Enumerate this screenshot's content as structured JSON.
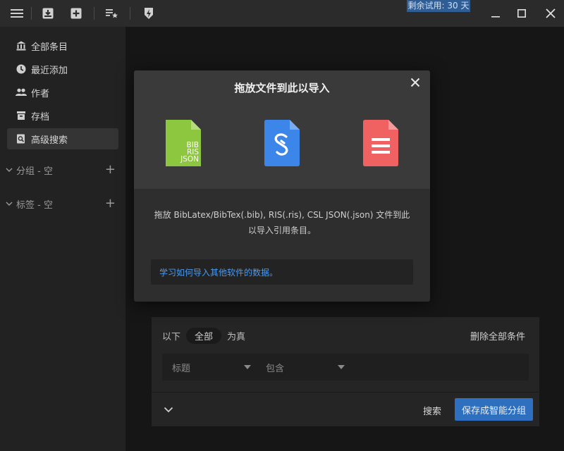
{
  "titlebar": {
    "trial_text": "剩余试用: 30 天",
    "icons": [
      "menu-icon",
      "import-icon",
      "add-icon",
      "playlist-star-icon",
      "lightning-icon"
    ]
  },
  "sidebar": {
    "items": [
      {
        "label": "全部条目",
        "icon": "library-icon"
      },
      {
        "label": "最近添加",
        "icon": "clock-icon"
      },
      {
        "label": "作者",
        "icon": "people-icon"
      },
      {
        "label": "存档",
        "icon": "archive-icon"
      },
      {
        "label": "高级搜索",
        "icon": "advanced-search-icon",
        "active": true
      }
    ],
    "groups": [
      {
        "label": "分组 - 空"
      },
      {
        "label": "标签 - 空"
      }
    ]
  },
  "search": {
    "prefix": "以下",
    "pill": "全部",
    "suffix": "为真",
    "delete_all": "删除全部条件",
    "field_select": "标题",
    "op_select": "包含",
    "search_button": "搜索",
    "save_button": "保存成智能分组"
  },
  "modal": {
    "title": "拖放文件到此以导入",
    "file_types": [
      {
        "name": "bib-ris-json",
        "lines": [
          "BIB",
          "RIS",
          "JSON"
        ],
        "color": "#8dc63f"
      },
      {
        "name": "link-file",
        "color": "#3b86e8"
      },
      {
        "name": "pdf-file",
        "color": "#f06262"
      }
    ],
    "description": "拖放 BibLatex/BibTex(.bib), RIS(.ris), CSL JSON(.json) 文件到此以导入引用条目。",
    "link": "学习如何导入其他软件的数据。"
  },
  "colors": {
    "accent": "#2f6fbf",
    "link": "#4a9af0",
    "trial_bg": "#2f5e96"
  }
}
